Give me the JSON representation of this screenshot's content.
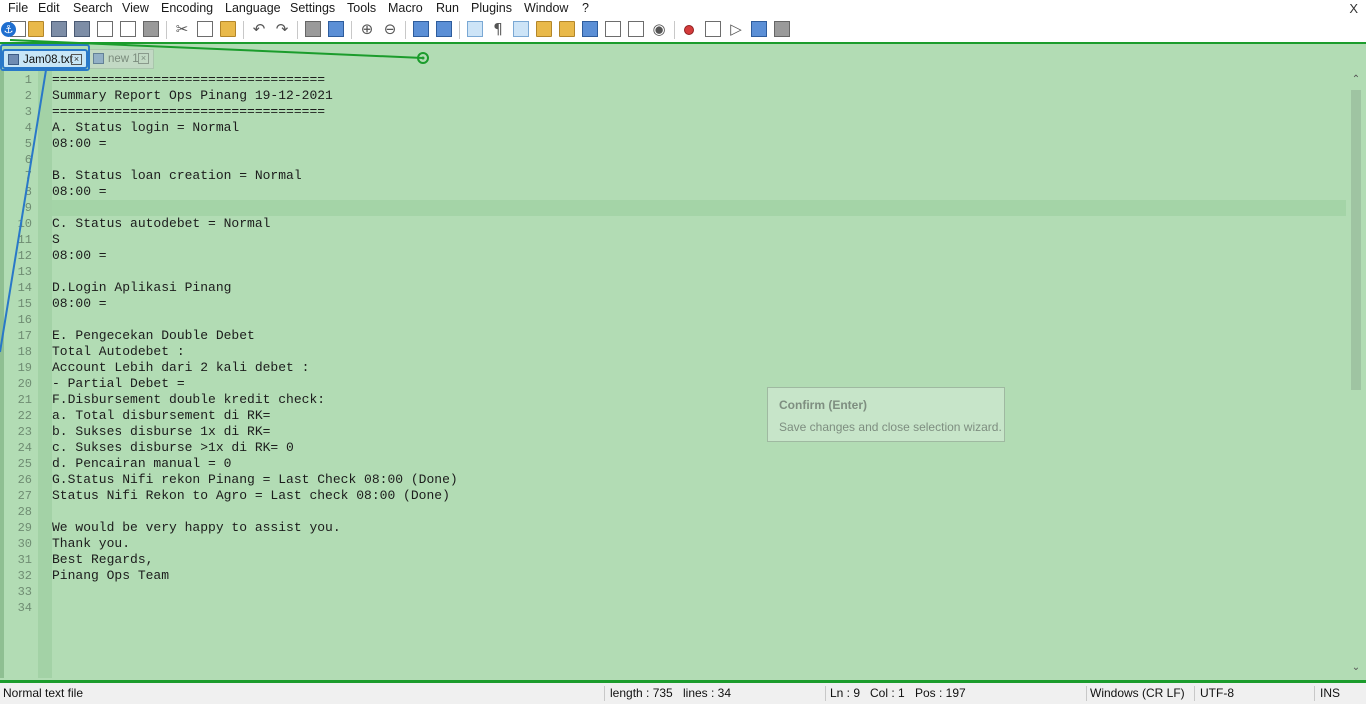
{
  "menu": {
    "items": [
      "File",
      "Edit",
      "Search",
      "View",
      "Encoding",
      "Language",
      "Settings",
      "Tools",
      "Macro",
      "Run",
      "Plugins",
      "Window",
      "?"
    ],
    "close": "X"
  },
  "toolbar": {
    "icons": [
      "new-file-icon",
      "open-file-icon",
      "save-icon",
      "save-all-icon",
      "close-icon",
      "close-all-icon",
      "print-icon",
      "cut-icon",
      "copy-icon",
      "paste-icon",
      "undo-icon",
      "redo-icon",
      "find-icon",
      "replace-icon",
      "zoom-in-icon",
      "zoom-out-icon",
      "sync-vertical-icon",
      "sync-horizontal-icon",
      "word-wrap-icon",
      "show-all-chars-icon",
      "indent-guide-icon",
      "folder-as-workspace-icon",
      "document-map-icon",
      "function-list-icon",
      "monitoring-icon",
      "record-macro-icon",
      "stop-record-icon",
      "play-macro-icon",
      "run-macro-multiple-icon",
      "save-macro-icon"
    ]
  },
  "tabs": [
    {
      "label": "Jam08.txt",
      "active": true
    },
    {
      "label": "new 1",
      "active": false
    }
  ],
  "editor": {
    "lines": [
      "===================================",
      "Summary Report Ops Pinang 19-12-2021",
      "===================================",
      "A. Status login = Normal",
      "08:00 =",
      "",
      "B. Status loan creation = Normal",
      "08:00 =",
      "",
      "C. Status autodebet = Normal",
      "S",
      "08:00 =",
      "",
      "D.Login Aplikasi Pinang",
      "08:00 =",
      "",
      "E. Pengecekan Double Debet",
      "Total Autodebet :",
      "Account Lebih dari 2 kali debet :",
      "- Partial Debet =",
      "F.Disbursement double kredit check:",
      "a. Total disbursement di RK=",
      "b. Sukses disburse 1x di RK=",
      "c. Sukses disburse >1x di RK= 0",
      "d. Pencairan manual = 0",
      "G.Status Nifi rekon Pinang = Last Check 08:00 (Done)",
      "Status Nifi Rekon to Agro = Last check 08:00 (Done)",
      "",
      "We would be very happy to assist you.",
      "Thank you.",
      "Best Regards,",
      "Pinang Ops Team",
      "",
      ""
    ],
    "current_line": 9
  },
  "tooltip": {
    "title": "Confirm (Enter)",
    "description": "Save changes and close selection wizard."
  },
  "status": {
    "file_type": "Normal text file",
    "length": "length : 735",
    "lines": "lines : 34",
    "ln": "Ln : 9",
    "col": "Col : 1",
    "pos": "Pos : 197",
    "eol": "Windows (CR LF)",
    "encoding": "UTF-8",
    "mode": "INS"
  },
  "colors": {
    "editor_bg": "#b2dcb4",
    "accent_green": "#1b9c2c",
    "selection_blue": "#2978c8"
  }
}
